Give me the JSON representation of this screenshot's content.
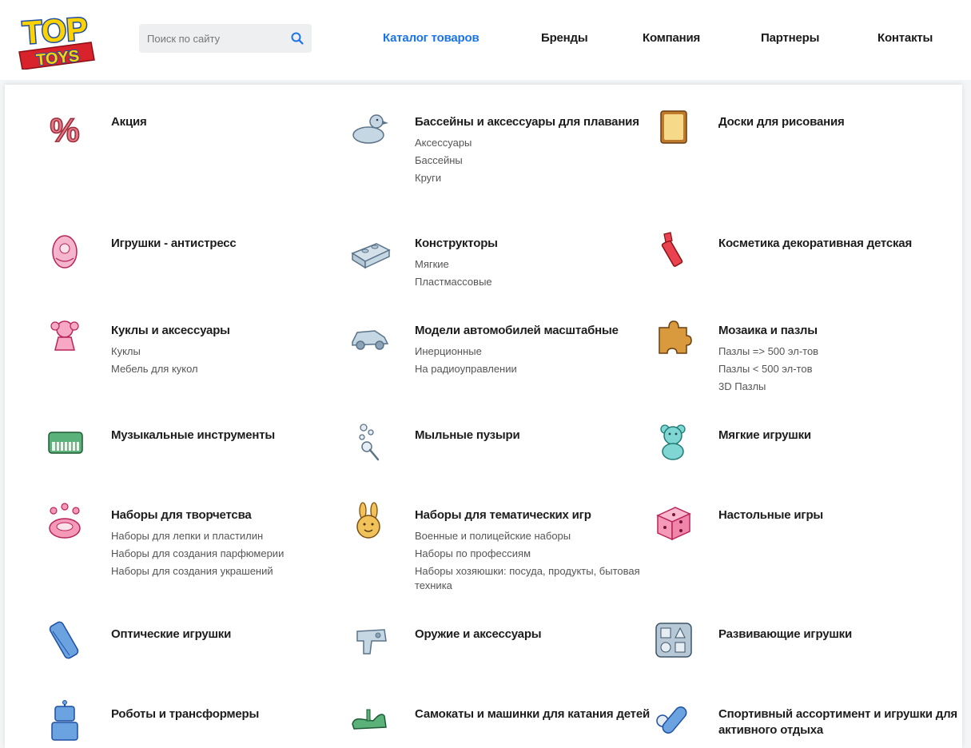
{
  "header": {
    "logo": {
      "line1": "TOP",
      "line2": "TOYS"
    },
    "search": {
      "placeholder": "Поиск по сайту"
    },
    "nav": [
      {
        "label": "Каталог товаров",
        "active": true
      },
      {
        "label": "Бренды"
      },
      {
        "label": "Компания"
      },
      {
        "label": "Партнеры"
      },
      {
        "label": "Контакты"
      }
    ]
  },
  "colors": {
    "accent": "#1a73e8",
    "logo_red": "#d9232c",
    "logo_yellow": "#ffd200",
    "logo_blue": "#1d4fa3"
  },
  "categories": [
    {
      "title": "Акция",
      "icon": "percent-icon",
      "subs": []
    },
    {
      "title": "Бассейны и аксессуары для плавания",
      "icon": "duck-icon",
      "subs": [
        "Аксессуары",
        "Бассейны",
        "Круги"
      ]
    },
    {
      "title": "Доски для рисования",
      "icon": "drawing-board-icon",
      "subs": []
    },
    {
      "title": "Игрушки - антистресс",
      "icon": "antistress-egg-icon",
      "subs": []
    },
    {
      "title": "Конструкторы",
      "icon": "building-brick-icon",
      "subs": [
        "Мягкие",
        "Пластмассовые"
      ]
    },
    {
      "title": "Косметика декоративная детская",
      "icon": "lipstick-icon",
      "subs": []
    },
    {
      "title": "Куклы и аксессуары",
      "icon": "doll-icon",
      "subs": [
        "Куклы",
        "Мебель для кукол"
      ]
    },
    {
      "title": "Модели автомобилей масштабные",
      "icon": "toy-car-icon",
      "subs": [
        "Инерционные",
        "На радиоуправлении"
      ]
    },
    {
      "title": "Мозаика и пазлы",
      "icon": "puzzle-piece-icon",
      "subs": [
        "Пазлы => 500 эл-тов",
        "Пазлы < 500 эл-тов",
        "3D Пазлы"
      ]
    },
    {
      "title": "Музыкальные инструменты",
      "icon": "keyboard-icon",
      "subs": []
    },
    {
      "title": "Мыльные пузыри",
      "icon": "soap-bubbles-icon",
      "subs": []
    },
    {
      "title": "Мягкие игрушки",
      "icon": "teddy-bear-icon",
      "subs": []
    },
    {
      "title": "Наборы для творчетсва",
      "icon": "craft-set-icon",
      "subs": [
        "Наборы для лепки и пластилин",
        "Наборы для создания парфюмерии",
        "Наборы для создания украшений"
      ]
    },
    {
      "title": "Наборы для тематических игр",
      "icon": "bunny-icon",
      "subs": [
        "Военные и полицейские наборы",
        "Наборы по профессиям",
        "Наборы хозяюшки: посуда, продукты, бытовая техника"
      ]
    },
    {
      "title": "Настольные игры",
      "icon": "dice-icon",
      "subs": []
    },
    {
      "title": "Оптические игрушки",
      "icon": "kaleidoscope-icon",
      "subs": []
    },
    {
      "title": "Оружие и аксессуары",
      "icon": "toy-gun-icon",
      "subs": []
    },
    {
      "title": "Развивающие игрушки",
      "icon": "shape-sorter-icon",
      "subs": []
    },
    {
      "title": "Роботы и трансформеры",
      "icon": "robot-icon",
      "subs": []
    },
    {
      "title": "Самокаты и машинки для катания детей",
      "icon": "ride-on-icon",
      "subs": []
    },
    {
      "title": "Спортивный ассортимент и игрушки для активного отдыха",
      "icon": "sports-icon",
      "subs": []
    }
  ]
}
